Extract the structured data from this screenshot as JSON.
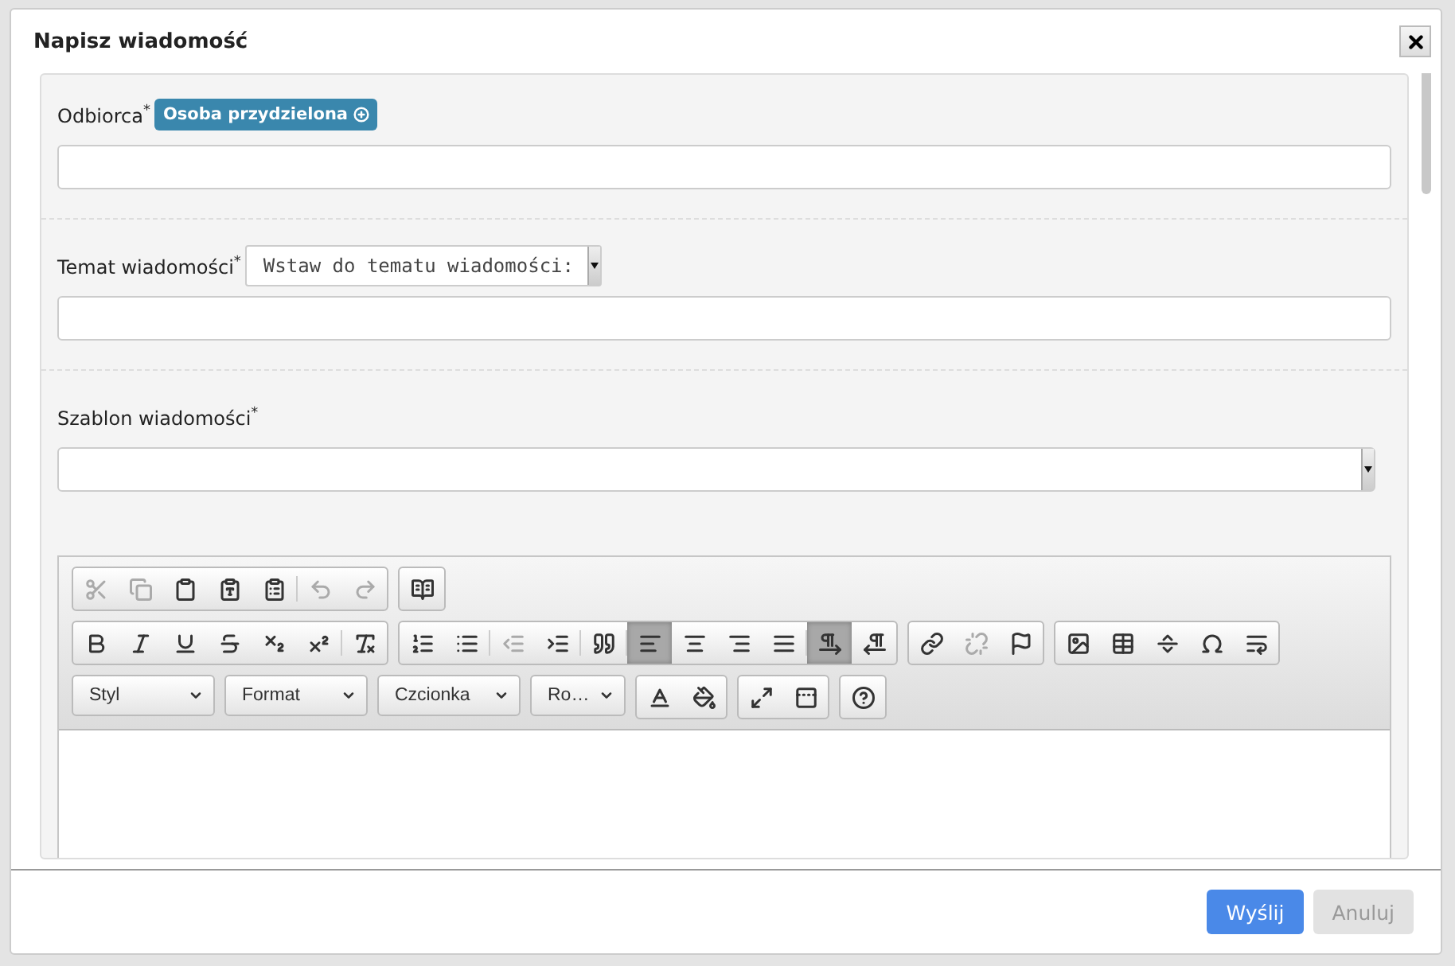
{
  "dialog": {
    "title": "Napisz wiadomość"
  },
  "recipient": {
    "label": "Odbiorca$^{*}$",
    "assign_button": "Osoba przydzielona"
  },
  "subject": {
    "label": "Temat wiadomości$^{*}$",
    "insert_select": "Wstaw do tematu wiadomości:"
  },
  "template": {
    "label": "Szablon wiadomości$^{*}$"
  },
  "editor": {
    "toolbar_rows": [
      [
        [
          {
            "kind": "cut",
            "disabled": true,
            "on": false
          },
          {
            "kind": "copy",
            "disabled": true,
            "on": false
          },
          {
            "kind": "paste",
            "disabled": false,
            "on": false
          },
          {
            "kind": "paste_text",
            "disabled": false,
            "on": false
          },
          {
            "kind": "paste_word",
            "disabled": false,
            "on": false
          },
          {
            "kind": "separator"
          },
          {
            "kind": "undo",
            "disabled": true,
            "on": false
          },
          {
            "kind": "redo",
            "disabled": true,
            "on": false
          }
        ],
        [
          {
            "kind": "spellcheck",
            "disabled": false,
            "on": false
          }
        ]
      ],
      [
        [
          {
            "kind": "bold",
            "disabled": false,
            "on": false
          },
          {
            "kind": "italic",
            "disabled": false,
            "on": false
          },
          {
            "kind": "underline",
            "disabled": false,
            "on": false
          },
          {
            "kind": "strike",
            "disabled": false,
            "on": false
          },
          {
            "kind": "subscript",
            "disabled": false,
            "on": false
          },
          {
            "kind": "superscript",
            "disabled": false,
            "on": false
          },
          {
            "kind": "separator"
          },
          {
            "kind": "remove_format",
            "disabled": false,
            "on": false
          }
        ],
        [
          {
            "kind": "ordered_list",
            "disabled": false,
            "on": false
          },
          {
            "kind": "bullet_list",
            "disabled": false,
            "on": false
          },
          {
            "kind": "separator"
          },
          {
            "kind": "outdent",
            "disabled": true,
            "on": false
          },
          {
            "kind": "indent",
            "disabled": false,
            "on": false
          },
          {
            "kind": "separator"
          },
          {
            "kind": "blockquote",
            "disabled": false,
            "on": false
          },
          {
            "kind": "separator"
          },
          {
            "kind": "align_left",
            "disabled": false,
            "on": true
          },
          {
            "kind": "align_center",
            "disabled": false,
            "on": false
          },
          {
            "kind": "align_right",
            "disabled": false,
            "on": false
          },
          {
            "kind": "align_justify",
            "disabled": false,
            "on": false
          },
          {
            "kind": "separator"
          },
          {
            "kind": "ltr",
            "disabled": false,
            "on": true
          },
          {
            "kind": "rtl",
            "disabled": false,
            "on": false
          }
        ],
        [
          {
            "kind": "link",
            "disabled": false,
            "on": false
          },
          {
            "kind": "unlink",
            "disabled": true,
            "on": false
          },
          {
            "kind": "anchor",
            "disabled": false,
            "on": false
          }
        ],
        [
          {
            "kind": "image",
            "disabled": false,
            "on": false
          },
          {
            "kind": "table",
            "disabled": false,
            "on": false
          },
          {
            "kind": "horizontal_line",
            "disabled": false,
            "on": false
          },
          {
            "kind": "special_char",
            "disabled": false,
            "on": false
          },
          {
            "kind": "page_break",
            "disabled": false,
            "on": false
          }
        ]
      ],
      [
        [
          {
            "kind": "combo",
            "label": "Styl"
          }
        ],
        [
          {
            "kind": "combo",
            "label": "Format"
          }
        ],
        [
          {
            "kind": "combo",
            "label": "Czcionka"
          }
        ],
        [
          {
            "kind": "combo",
            "label": "Ro…"
          }
        ],
        [
          {
            "kind": "text_color",
            "disabled": false,
            "on": false
          },
          {
            "kind": "bg_color",
            "disabled": false,
            "on": false
          }
        ],
        [
          {
            "kind": "maximize",
            "disabled": false,
            "on": false
          },
          {
            "kind": "show_blocks",
            "disabled": false,
            "on": false
          }
        ],
        [
          {
            "kind": "help",
            "disabled": false,
            "on": false
          }
        ]
      ]
    ]
  },
  "buttons": [
    {
      "label": "Wyślij",
      "kind": "primary",
      "disabled": false
    },
    {
      "label": "Anuluj",
      "kind": "secondary",
      "disabled": true
    }
  ]
}
